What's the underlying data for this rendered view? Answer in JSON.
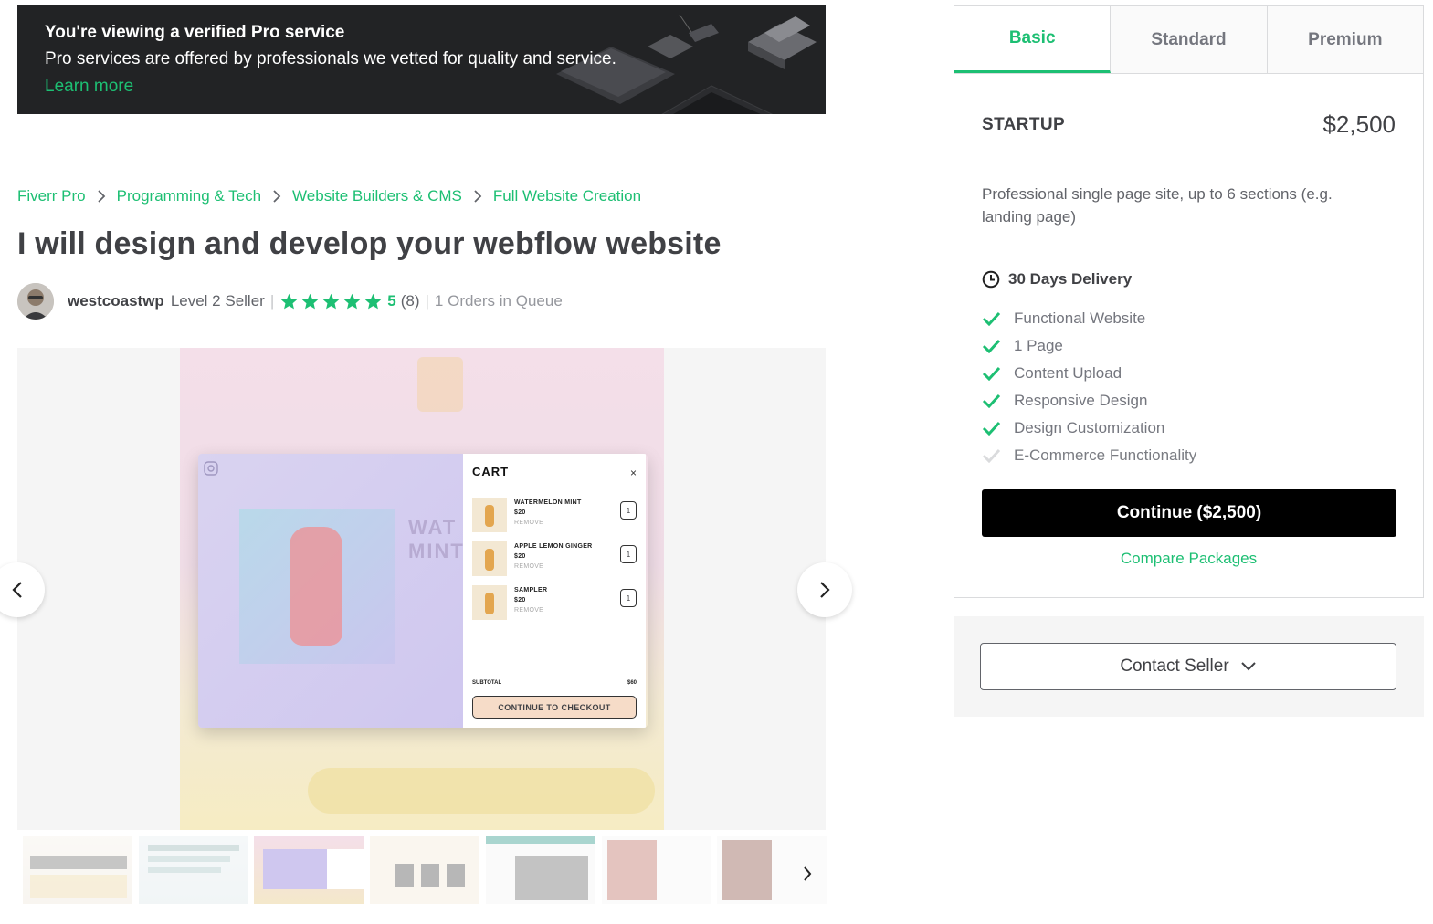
{
  "banner": {
    "title": "You're viewing a verified Pro service",
    "subtitle": "Pro services are offered by professionals we vetted for quality and service.",
    "link": "Learn more"
  },
  "breadcrumb": [
    "Fiverr Pro",
    "Programming & Tech",
    "Website Builders & CMS",
    "Full Website Creation"
  ],
  "gig": {
    "title": "I will design and develop your webflow website",
    "seller_name": "westcoastwp",
    "seller_level": "Level 2 Seller",
    "rating": "5",
    "rating_count": "(8)",
    "queue": "1 Orders in Queue",
    "stars": 5
  },
  "gallery": {
    "slide": {
      "hero_text_line1": "WAT",
      "hero_text_line2": "MINT",
      "cart_title": "CART",
      "cart_close": "×",
      "items": [
        {
          "name": "WATERMELON MINT",
          "price": "$20",
          "remove": "REMOVE",
          "qty": "1"
        },
        {
          "name": "APPLE LEMON GINGER",
          "price": "$20",
          "remove": "REMOVE",
          "qty": "1"
        },
        {
          "name": "SAMPLER",
          "price": "$20",
          "remove": "REMOVE",
          "qty": "1"
        }
      ],
      "subtotal_label": "SUBTOTAL",
      "subtotal_value": "$60",
      "checkout": "CONTINUE TO CHECKOUT"
    },
    "thumb_count": 7,
    "active_thumb": 2
  },
  "package": {
    "tabs": [
      "Basic",
      "Standard",
      "Premium"
    ],
    "active_tab": 0,
    "name": "STARTUP",
    "price": "$2,500",
    "description": "Professional single page site, up to 6 sections (e.g. landing page)",
    "delivery": "30 Days Delivery",
    "features": [
      {
        "label": "Functional Website",
        "included": true
      },
      {
        "label": "1 Page",
        "included": true
      },
      {
        "label": "Content Upload",
        "included": true
      },
      {
        "label": "Responsive Design",
        "included": true
      },
      {
        "label": "Design Customization",
        "included": true
      },
      {
        "label": "E-Commerce Functionality",
        "included": false
      }
    ],
    "continue": "Continue ($2,500)",
    "compare": "Compare Packages"
  },
  "contact": {
    "label": "Contact Seller"
  },
  "colors": {
    "accent": "#1dbf73",
    "dark": "#222325",
    "text": "#404145",
    "muted": "#62646a"
  }
}
